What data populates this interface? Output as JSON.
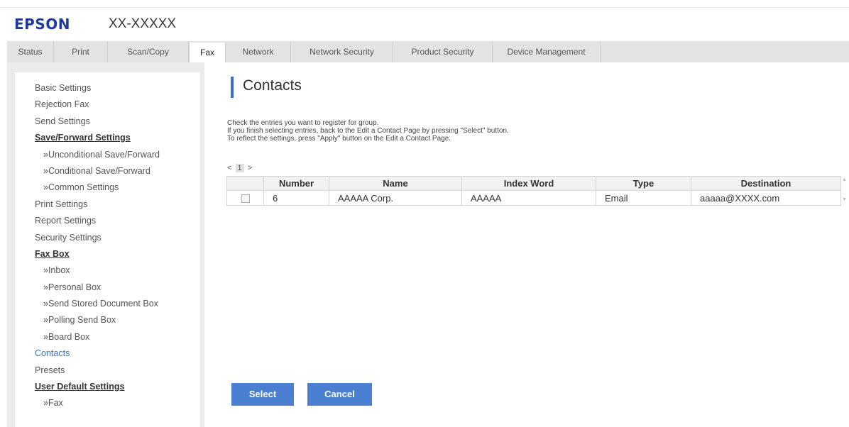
{
  "brand": "EPSON",
  "model": "XX-XXXXX",
  "tabs": [
    {
      "label": "Status"
    },
    {
      "label": "Print"
    },
    {
      "label": "Scan/Copy"
    },
    {
      "label": "Fax",
      "active": true
    },
    {
      "label": "Network"
    },
    {
      "label": "Network Security"
    },
    {
      "label": "Product Security"
    },
    {
      "label": "Device Management"
    }
  ],
  "sidebar": {
    "items": [
      {
        "label": "Basic Settings"
      },
      {
        "label": "Rejection Fax"
      },
      {
        "label": "Send Settings"
      },
      {
        "label": "Save/Forward Settings",
        "style": "bold"
      },
      {
        "label": "»Unconditional Save/Forward",
        "style": "sub"
      },
      {
        "label": "»Conditional Save/Forward",
        "style": "sub"
      },
      {
        "label": "»Common Settings",
        "style": "sub"
      },
      {
        "label": "Print Settings"
      },
      {
        "label": "Report Settings"
      },
      {
        "label": "Security Settings"
      },
      {
        "label": "Fax Box",
        "style": "bold"
      },
      {
        "label": "»Inbox",
        "style": "sub"
      },
      {
        "label": "»Personal Box",
        "style": "sub"
      },
      {
        "label": "»Send Stored Document Box",
        "style": "sub"
      },
      {
        "label": "»Polling Send Box",
        "style": "sub"
      },
      {
        "label": "»Board Box",
        "style": "sub"
      },
      {
        "label": "Contacts",
        "style": "active"
      },
      {
        "label": "Presets"
      },
      {
        "label": "User Default Settings",
        "style": "bold"
      },
      {
        "label": "»Fax",
        "style": "sub"
      }
    ]
  },
  "page": {
    "title": "Contacts",
    "instructions": [
      "Check the entries you want to register for group.",
      "If you finish selecting entries, back to the Edit a Contact Page by pressing \"Select\" button.",
      "To reflect the settings, press \"Apply\" button on the Edit a Contact Page."
    ],
    "pager": {
      "prev": "<",
      "current": "1",
      "next": ">"
    }
  },
  "table": {
    "headers": [
      "Number",
      "Name",
      "Index Word",
      "Type",
      "Destination"
    ],
    "rows": [
      {
        "checked": false,
        "cells": [
          "6",
          "AAAAA Corp.",
          "AAAAA",
          "Email",
          "aaaaa@XXXX.com"
        ]
      }
    ]
  },
  "buttons": {
    "select": "Select",
    "cancel": "Cancel"
  },
  "colors": {
    "brand": "#1f3b99",
    "accent": "#4a7fd1",
    "active_link": "#3a71c9"
  }
}
